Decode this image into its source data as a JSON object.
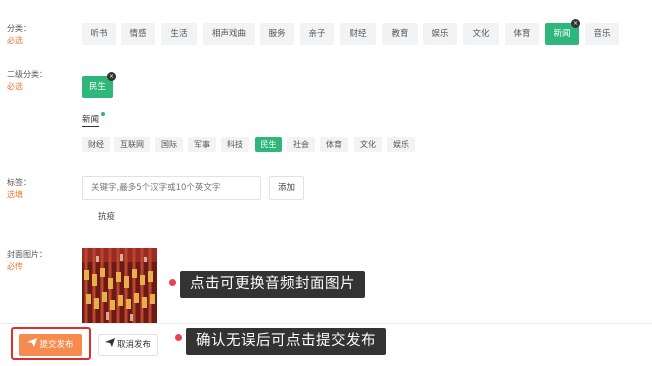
{
  "category": {
    "label": "分类：",
    "required": "必选",
    "tags": [
      "听书",
      "情感",
      "生活",
      "相声戏曲",
      "服务",
      "亲子",
      "财经",
      "教育",
      "娱乐",
      "文化",
      "体育",
      "新闻",
      "音乐"
    ],
    "active": "新闻",
    "close_glyph": "×"
  },
  "subcategory": {
    "label": "二级分类：",
    "required": "必选",
    "selected": "民生",
    "close_glyph": "×",
    "group_tab": "新闻",
    "options": [
      "财经",
      "互联网",
      "国际",
      "军事",
      "科技",
      "民生",
      "社会",
      "体育",
      "文化",
      "娱乐"
    ],
    "active": "民生"
  },
  "tags_field": {
    "label": "标签：",
    "required": "选填",
    "placeholder": "关键字,最多5个汉字或10个英文字",
    "add_label": "添加",
    "chips": [
      "抗疫"
    ]
  },
  "cover": {
    "label": "封面图片：",
    "required": "必传"
  },
  "annotations": {
    "cover_hint": "点击可更换音频封面图片",
    "submit_hint": "确认无误后可点击提交发布"
  },
  "actions": {
    "submit_label": "提交发布",
    "cancel_label": "取消发布",
    "submit_icon": "send-icon",
    "cancel_icon": "send-icon"
  },
  "colors": {
    "accent_green": "#2fb67a",
    "orange": "#f58b4f",
    "required_text": "#f5762d",
    "highlight_red": "#e02d2d",
    "annotation_bg": "#222222",
    "annotation_dot": "#e6434f"
  }
}
